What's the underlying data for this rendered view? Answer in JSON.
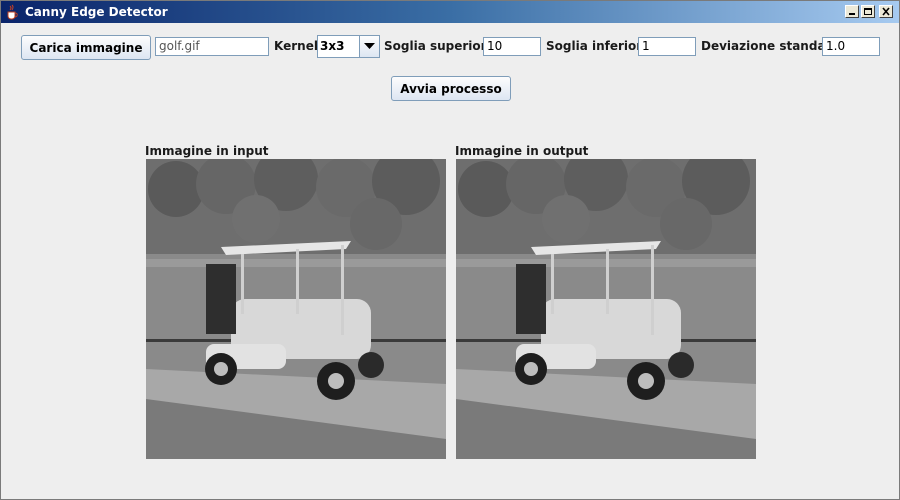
{
  "window": {
    "title": "Canny Edge Detector",
    "controls": [
      "minimize-icon",
      "maximize-icon",
      "close-icon"
    ]
  },
  "toolbar": {
    "load_label": "Carica immagine",
    "filename": "golf.gif",
    "kernel_label": "Kernel",
    "kernel_value": "3x3",
    "upper_label": "Soglia superiore",
    "upper_value": "10",
    "lower_label": "Soglia inferiore",
    "lower_value": "1",
    "stddev_label": "Deviazione standard",
    "stddev_value": "1.0",
    "run_label": "Avvia processo"
  },
  "images": {
    "input_label": "Immagine in input",
    "output_label": "Immagine in output"
  },
  "colors": {
    "titlebar_start": "#0a246a",
    "titlebar_end": "#a6caf0",
    "window_bg": "#eeeeee",
    "field_border": "#7f9db9"
  }
}
